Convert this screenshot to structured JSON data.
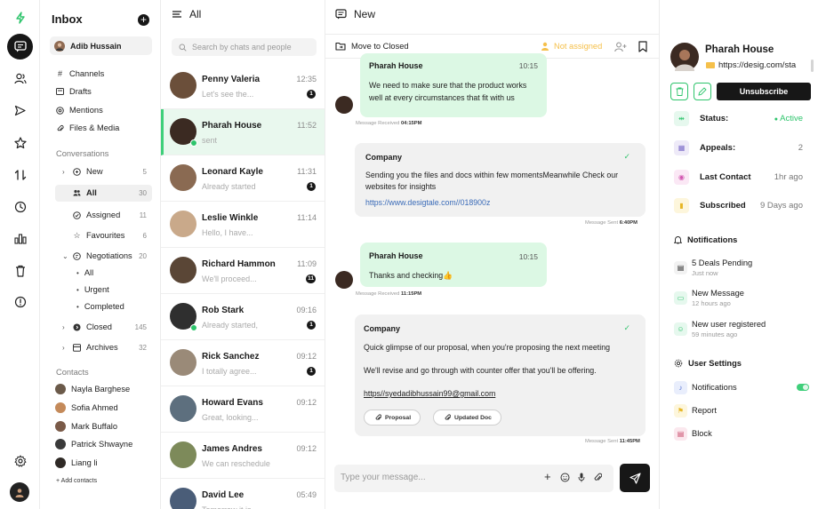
{
  "sidebar": {
    "title": "Inbox",
    "user": "Adib Hussain",
    "nav": [
      "Channels",
      "Drafts",
      "Mentions",
      "Files & Media"
    ],
    "conversations_label": "Conversations",
    "folders": [
      {
        "label": "New",
        "count": "5"
      },
      {
        "label": "All",
        "count": "30"
      },
      {
        "label": "Assigned",
        "count": "11"
      },
      {
        "label": "Favourites",
        "count": "6"
      },
      {
        "label": "Negotiations",
        "count": "20"
      },
      {
        "label": "All",
        "count": ""
      },
      {
        "label": "Urgent",
        "count": ""
      },
      {
        "label": "Completed",
        "count": ""
      },
      {
        "label": "Closed",
        "count": "145"
      },
      {
        "label": "Archives",
        "count": "32"
      }
    ],
    "contacts_label": "Contacts",
    "contacts": [
      "Nayla Barghese",
      "Sofia Ahmed",
      "Mark Buffalo",
      "Patrick Shwayne",
      "Liang li"
    ],
    "add_contacts": "+ Add contacts"
  },
  "chatlist": {
    "title": "All",
    "search_placeholder": "Search by chats and people",
    "chats": [
      {
        "name": "Penny Valeria",
        "preview": "Let's see the...",
        "time": "12:35",
        "badge": "1",
        "color": "#6b4f3a"
      },
      {
        "name": "Pharah House",
        "preview": "sent",
        "time": "11:52",
        "badge": "",
        "color": "#3b2a22"
      },
      {
        "name": "Leonard Kayle",
        "preview": "Already started",
        "time": "11:31",
        "badge": "1",
        "color": "#8a6a52"
      },
      {
        "name": "Leslie Winkle",
        "preview": "Hello, I have...",
        "time": "11:14",
        "badge": "",
        "color": "#c9a98a"
      },
      {
        "name": "Richard Hammon",
        "preview": "We'll proceed...",
        "time": "11:09",
        "badge": "11",
        "color": "#5a4636"
      },
      {
        "name": "Rob Stark",
        "preview": "Already started,",
        "time": "09:16",
        "badge": "1",
        "color": "#2f2f2f"
      },
      {
        "name": "Rick Sanchez",
        "preview": "I totally agree...",
        "time": "09:12",
        "badge": "1",
        "color": "#9a8a78"
      },
      {
        "name": "Howard Evans",
        "preview": "Great, looking...",
        "time": "09:12",
        "badge": "",
        "color": "#5d6f7e"
      },
      {
        "name": "James Andres",
        "preview": "We can reschedule",
        "time": "09:12",
        "badge": "",
        "color": "#7d8a5a"
      },
      {
        "name": "David Lee",
        "preview": "Tomorrow it is...",
        "time": "05:49",
        "badge": "",
        "color": "#4a5d78"
      }
    ]
  },
  "chat": {
    "title": "New",
    "move_to_closed": "Move to Closed",
    "not_assigned": "Not assigned",
    "messages": [
      {
        "sender": "Pharah House",
        "time": "10:15",
        "lines": [
          "We need to make sure that the product works",
          "well at every circumstances that fit with us"
        ],
        "meta_label": "Message Received",
        "meta_time": "04:15PM"
      },
      {
        "sender": "Company",
        "lines": [
          "Sending you the files and docs within few momentsMeanwhile Check our",
          "websites for insights"
        ],
        "link": "https://www.desigtale.com//018900z",
        "meta_label": "Message Sent",
        "meta_time": "6:40PM"
      },
      {
        "sender": "Pharah House",
        "time": "10:15",
        "lines": [
          "Thanks and checking👍"
        ],
        "meta_label": "Message Received",
        "meta_time": "11:15PM"
      },
      {
        "sender": "Company",
        "lines": [
          "Quick glimpse of our proposal, when you're proposing the next meeting",
          "We'll revise and go through with counter offer that you'll be offering."
        ],
        "link": "https//syedadibhussain99@gmail.com",
        "attachments": [
          "Proposal",
          "Updated Doc"
        ],
        "meta_label": "Message Sent",
        "meta_time": "11:45PM"
      }
    ],
    "composer_placeholder": "Type your message..."
  },
  "profile": {
    "name": "Pharah House",
    "url": "https://desig.com/sta",
    "unsubscribe": "Unsubscribe",
    "stats": [
      {
        "label": "Status:",
        "value": "Active"
      },
      {
        "label": "Appeals:",
        "value": "2"
      },
      {
        "label": "Last Contact",
        "value": "1hr ago"
      },
      {
        "label": "Subscribed",
        "value": "9 Days ago"
      }
    ],
    "notifications_title": "Notifications",
    "notifications": [
      {
        "title": "5 Deals Pending",
        "sub": "Just now"
      },
      {
        "title": "New Message",
        "sub": "12 hours ago"
      },
      {
        "title": "New user registered",
        "sub": "59 minutes ago"
      }
    ],
    "settings_title": "User Settings",
    "settings": [
      "Notifications",
      "Report",
      "Block"
    ]
  },
  "colors": {
    "accent": "#2dc46b",
    "dark": "#171717",
    "warning": "#f5c04b",
    "incoming_bubble": "#dcf8e4"
  }
}
